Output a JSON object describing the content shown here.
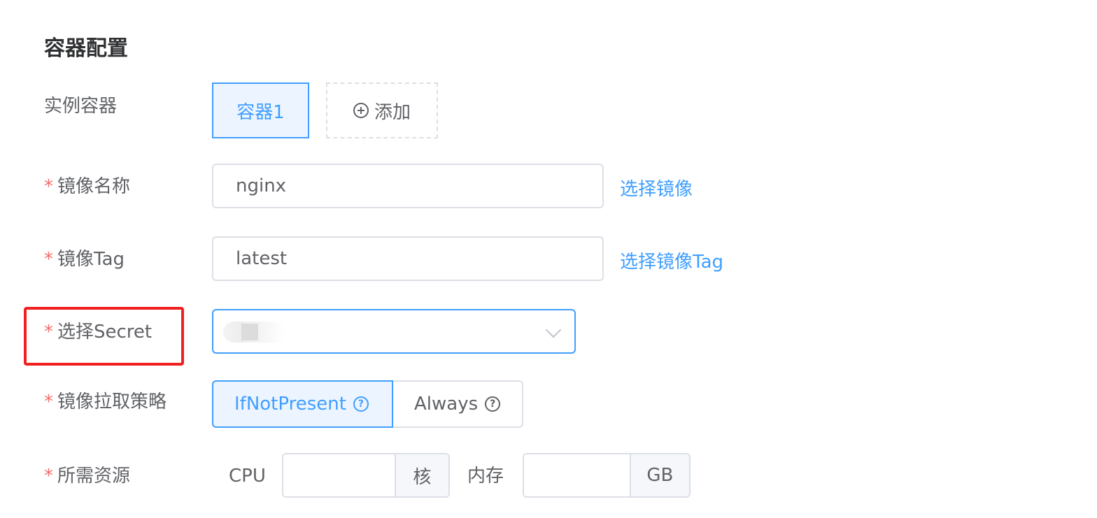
{
  "section": {
    "title": "容器配置"
  },
  "labels": {
    "instance_containers": "实例容器",
    "image_name": "镜像名称",
    "image_tag": "镜像Tag",
    "select_secret": "选择Secret",
    "pull_policy": "镜像拉取策略",
    "resources": "所需资源",
    "required_mark": "*"
  },
  "containers": {
    "tabs": [
      "容器1"
    ],
    "add_label": "添加"
  },
  "image": {
    "name_value": "nginx",
    "select_image_link": "选择镜像",
    "tag_value": "latest",
    "select_tag_link": "选择镜像Tag"
  },
  "secret": {
    "selected_value": ""
  },
  "pull_policy": {
    "options": [
      "IfNotPresent",
      "Always"
    ],
    "selected": "IfNotPresent"
  },
  "resources": {
    "cpu_label": "CPU",
    "cpu_value": "",
    "cpu_unit": "核",
    "memory_label": "内存",
    "memory_value": "",
    "memory_unit": "GB"
  },
  "colors": {
    "accent": "#409eff",
    "required": "#f56c6c",
    "highlight_box": "#f02020"
  }
}
